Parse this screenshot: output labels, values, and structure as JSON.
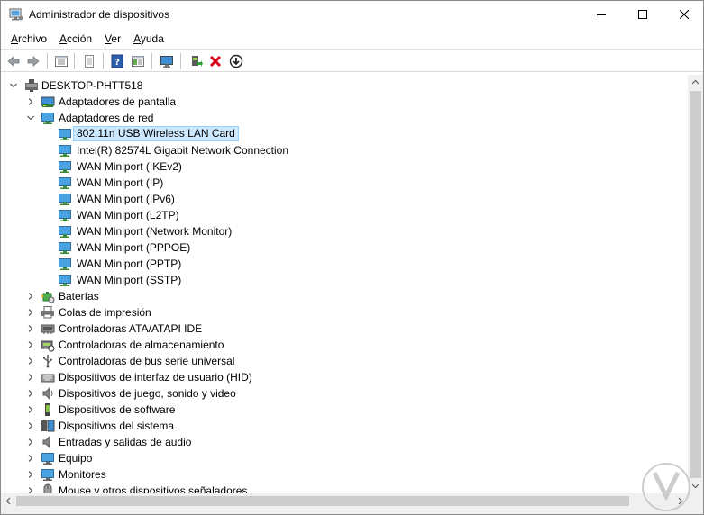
{
  "window": {
    "title": "Administrador de dispositivos",
    "icon": "device-manager-icon"
  },
  "menu": {
    "items": [
      {
        "accel": "A",
        "rest": "rchivo"
      },
      {
        "accel": "A",
        "rest": "cción"
      },
      {
        "accel": "V",
        "rest": "er"
      },
      {
        "accel": "A",
        "rest": "yuda"
      }
    ]
  },
  "toolbar": {
    "buttons": [
      "back-arrow-icon",
      "forward-arrow-icon",
      "properties-panel-icon",
      "print-icon",
      "help-icon",
      "show-panel-icon",
      "monitor-icon",
      "update-driver-icon",
      "uninstall-x-icon",
      "download-circle-icon"
    ]
  },
  "tree": {
    "root": "DESKTOP-PHTT518",
    "items": [
      {
        "label": "Adaptadores de pantalla",
        "icon": "display-adapter-icon",
        "expanded": false
      },
      {
        "label": "Adaptadores de red",
        "icon": "network-adapter-icon",
        "expanded": true,
        "children": [
          "802.11n USB Wireless LAN Card",
          "Intel(R) 82574L Gigabit Network Connection",
          "WAN Miniport (IKEv2)",
          "WAN Miniport (IP)",
          "WAN Miniport (IPv6)",
          "WAN Miniport (L2TP)",
          "WAN Miniport (Network Monitor)",
          "WAN Miniport (PPPOE)",
          "WAN Miniport (PPTP)",
          "WAN Miniport (SSTP)"
        ]
      },
      {
        "label": "Baterías",
        "icon": "battery-icon"
      },
      {
        "label": "Colas de impresión",
        "icon": "printer-icon"
      },
      {
        "label": "Controladoras ATA/ATAPI IDE",
        "icon": "ide-controller-icon"
      },
      {
        "label": "Controladoras de almacenamiento",
        "icon": "storage-controller-icon"
      },
      {
        "label": "Controladoras de bus serie universal",
        "icon": "usb-icon"
      },
      {
        "label": "Dispositivos de interfaz de usuario (HID)",
        "icon": "hid-icon"
      },
      {
        "label": "Dispositivos de juego, sonido y video",
        "icon": "speaker-icon"
      },
      {
        "label": "Dispositivos de software",
        "icon": "software-device-icon"
      },
      {
        "label": "Dispositivos del sistema",
        "icon": "system-device-icon"
      },
      {
        "label": "Entradas y salidas de audio",
        "icon": "audio-io-icon"
      },
      {
        "label": "Equipo",
        "icon": "computer-icon"
      },
      {
        "label": "Monitores",
        "icon": "monitor-icon"
      },
      {
        "label": "Mouse y otros dispositivos señaladores",
        "icon": "mouse-icon"
      }
    ],
    "selected": "802.11n USB Wireless LAN Card"
  },
  "colors": {
    "selection_bg": "#cce8ff",
    "selection_border": "#99d1ff",
    "accent_blue": "#1e73be",
    "uninstall_red": "#d9001b"
  }
}
